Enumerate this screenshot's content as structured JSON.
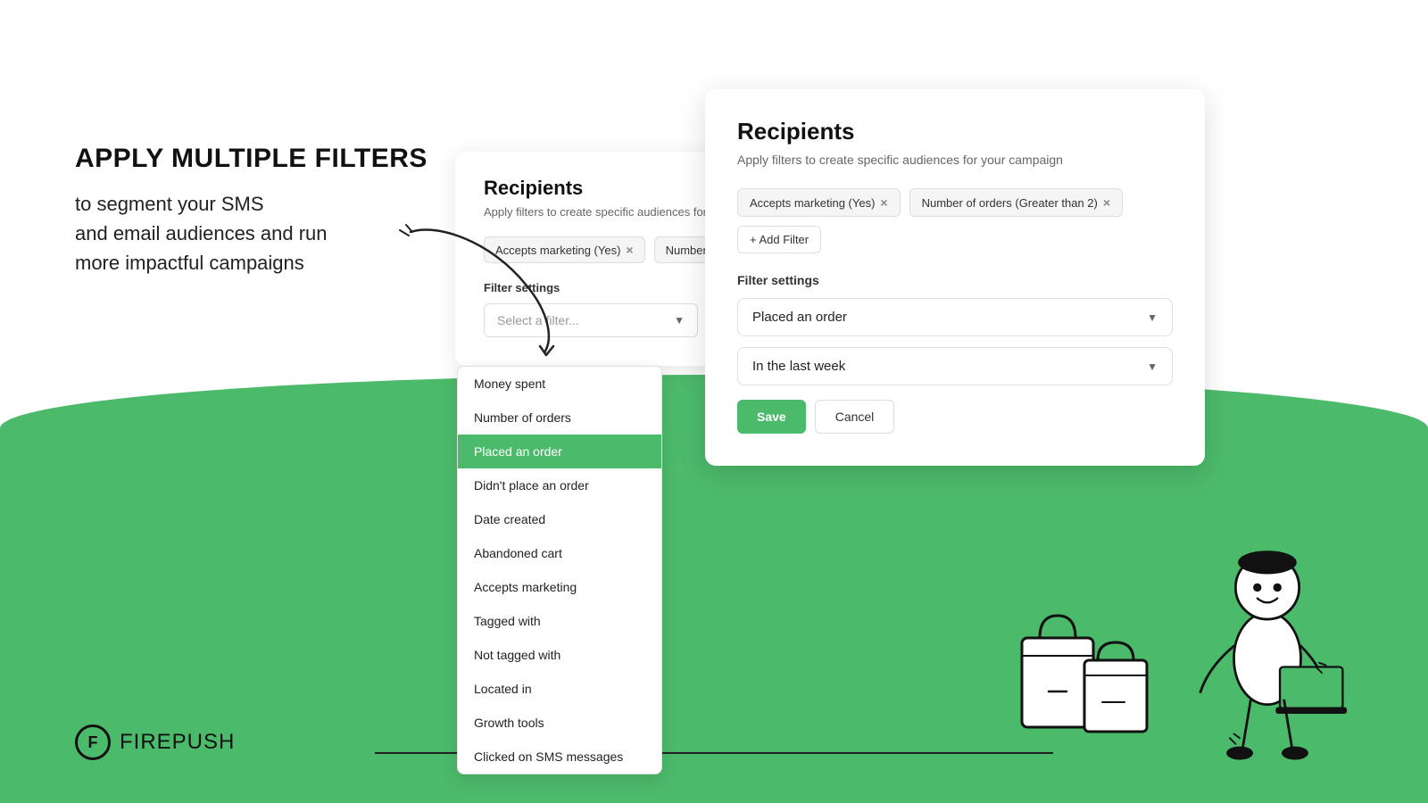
{
  "page": {
    "background_color": "#ffffff",
    "green_color": "#4cba6b"
  },
  "left": {
    "headline": "APPLY MULTIPLE FILTERS",
    "body_line1": "to segment your SMS",
    "body_line2": "and email audiences and run",
    "body_line3": "more impactful campaigns"
  },
  "logo": {
    "symbol": "F",
    "text_bold": "FIRE",
    "text_light": "PUSH"
  },
  "card_back": {
    "title": "Recipients",
    "subtitle": "Apply filters to create specific audiences for your car...",
    "filter_tags": [
      {
        "label": "Accepts marketing (Yes)",
        "has_x": true
      },
      {
        "label": "Number of orders (Greate...",
        "has_x": false
      }
    ],
    "filter_settings_label": "Filter settings",
    "select_placeholder": "Select a filter..."
  },
  "dropdown": {
    "items": [
      {
        "label": "Money spent",
        "selected": false
      },
      {
        "label": "Number of orders",
        "selected": false
      },
      {
        "label": "Placed an order",
        "selected": true
      },
      {
        "label": "Didn't place an order",
        "selected": false
      },
      {
        "label": "Date created",
        "selected": false
      },
      {
        "label": "Abandoned cart",
        "selected": false
      },
      {
        "label": "Accepts marketing",
        "selected": false
      },
      {
        "label": "Tagged with",
        "selected": false
      },
      {
        "label": "Not tagged with",
        "selected": false
      },
      {
        "label": "Located in",
        "selected": false
      },
      {
        "label": "Growth tools",
        "selected": false
      },
      {
        "label": "Clicked on SMS messages",
        "selected": false
      }
    ]
  },
  "card_front": {
    "title": "Recipients",
    "subtitle": "Apply filters to create specific audiences for your campaign",
    "filter_tags": [
      {
        "label": "Accepts marketing (Yes)",
        "has_x": true
      },
      {
        "label": "Number of orders (Greater than 2)",
        "has_x": true
      }
    ],
    "add_filter_label": "+ Add Filter",
    "filter_settings_label": "Filter settings",
    "select_value": "Placed an order",
    "select_value2": "In the last week",
    "save_label": "Save",
    "cancel_label": "Cancel"
  }
}
